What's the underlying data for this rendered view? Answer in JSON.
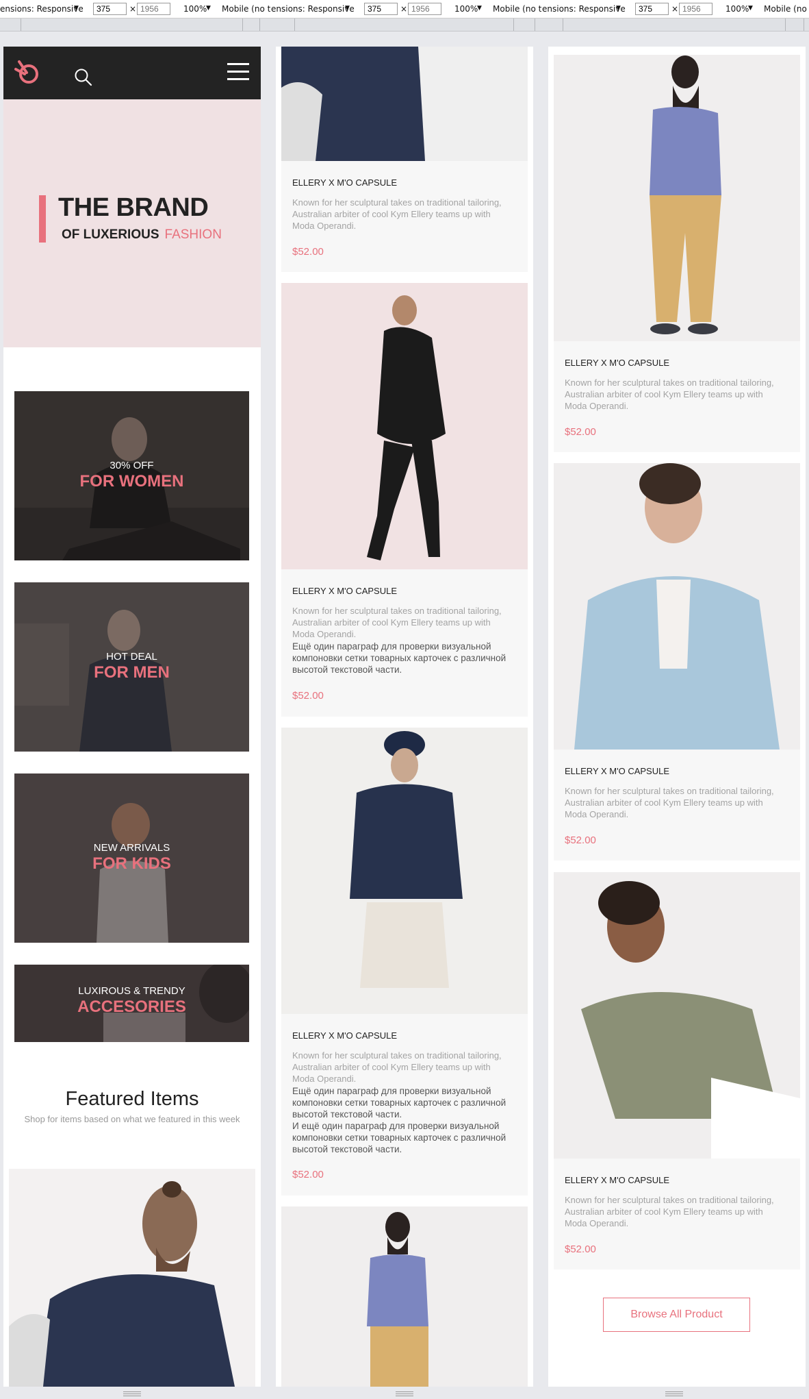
{
  "devtools": {
    "dimensions_label": "ensions: Responsive",
    "width_value": "375",
    "times": "×",
    "height_placeholder": "1956",
    "zoom": "100%",
    "mobile_label": "Mobile (no t"
  },
  "hero": {
    "title": "THE BRAND",
    "subtitle_a": "OF LUXERIOUS",
    "subtitle_b": "FASHION"
  },
  "categories": [
    {
      "line1": "30% OFF",
      "line2": "FOR WOMEN"
    },
    {
      "line1": "HOT DEAL",
      "line2": "FOR MEN"
    },
    {
      "line1": "NEW ARRIVALS",
      "line2": "FOR KIDS"
    },
    {
      "line1": "LUXIROUS & TRENDY",
      "line2": "ACCESORIES"
    }
  ],
  "featured": {
    "title": "Featured Items",
    "subtitle": "Shop for items based on what we featured in this week"
  },
  "product": {
    "title": "ELLERY X M'O CAPSULE",
    "desc": "Known for her sculptural takes on traditional tailoring, Australian arbiter of cool Kym Ellery teams up with Moda Operandi.",
    "extra": "Ещё один параграф для проверки визуальной компоновки сетки товарных карточек с различной высотой текстовой части.",
    "extra2": "И ещё один параграф для проверки визуальной компоновки сетки товарных карточек с различной высотой текстовой части.",
    "price": "$52.00"
  },
  "browse_label": "Browse All Product",
  "colors": {
    "accent": "#e8717d",
    "header": "#232323",
    "hero_bg": "#f0e1e3"
  }
}
